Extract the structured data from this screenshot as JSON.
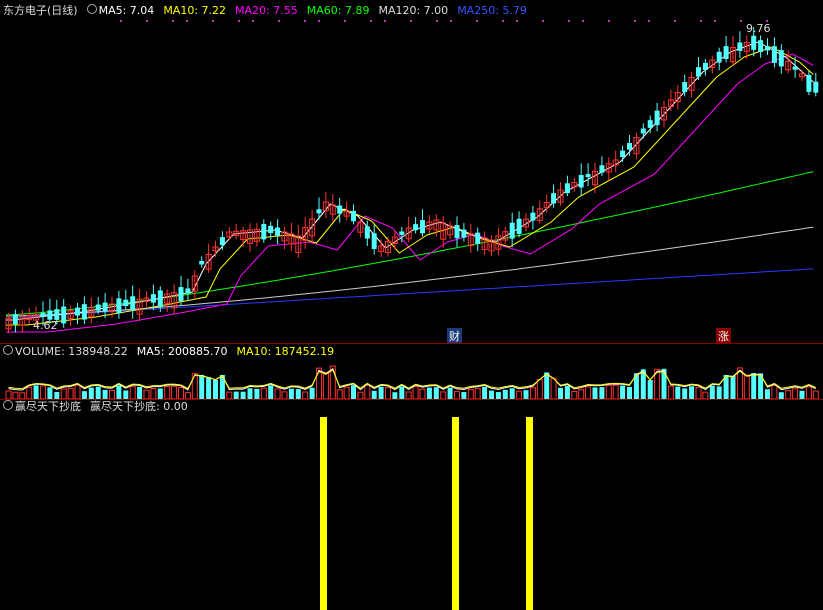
{
  "price": {
    "title": "东方电子(日线)",
    "indicators": [
      {
        "label": "MA5: 7.04",
        "color": "#ffffff"
      },
      {
        "label": "MA10: 7.22",
        "color": "#ffff00"
      },
      {
        "label": "MA20: 7.55",
        "color": "#ff00ff"
      },
      {
        "label": "MA60: 7.89",
        "color": "#00ff00"
      },
      {
        "label": "MA120: 7.00",
        "color": "#dddddd"
      },
      {
        "label": "MA250: 5.79",
        "color": "#3355ff"
      }
    ],
    "high_label": "9.76",
    "low_label": "4.62",
    "marker_cai": "财",
    "marker_zhang": "涨"
  },
  "volume": {
    "title": "VOLUME: 138948.22",
    "ma5": "MA5: 200885.70",
    "ma10": "MA10: 187452.19"
  },
  "indicator": {
    "name": "赢尽天下抄底",
    "value_label": "赢尽天下抄底: 0.00",
    "signals": [
      {
        "date_index": 56
      },
      {
        "date_index": 81
      },
      {
        "date_index": 94
      }
    ]
  },
  "colors": {
    "up": "#ff3232",
    "down": "#54ffff",
    "signal": "#ffff00",
    "separator": "#8b0000"
  }
}
